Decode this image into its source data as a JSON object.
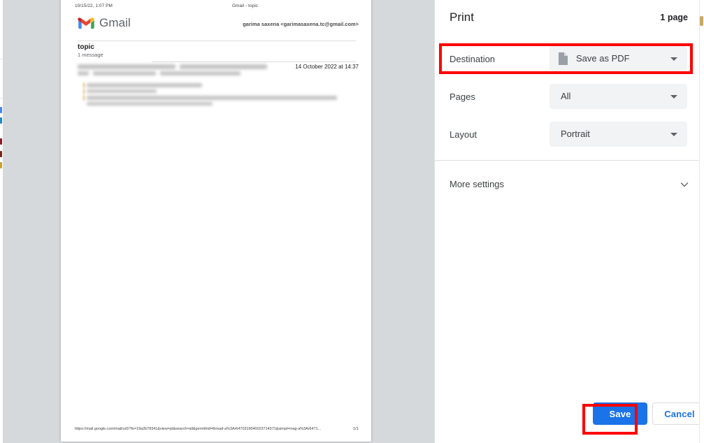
{
  "dialog": {
    "title": "Print",
    "page_count": "1 page",
    "settings": [
      {
        "id": "destination",
        "label": "Destination",
        "value": "Save as PDF",
        "icon": "pdf-document-icon",
        "highlighted": true
      },
      {
        "id": "pages",
        "label": "Pages",
        "value": "All",
        "icon": null,
        "highlighted": false
      },
      {
        "id": "layout",
        "label": "Layout",
        "value": "Portrait",
        "icon": null,
        "highlighted": false
      }
    ],
    "more_settings": {
      "label": "More settings",
      "icon": "chevron-down-icon",
      "expanded": false
    },
    "footer": {
      "save_label": "Save",
      "cancel_label": "Cancel"
    }
  },
  "preview": {
    "document": {
      "header_left": "10/15/22, 1:07 PM",
      "header_right": "Gmail - topic",
      "brand": "Gmail",
      "brand_icon": "gmail-m-icon",
      "account": "garima saxena <garimasaxena.tc@gmail.com>",
      "subject": "topic",
      "message_count": "1 message",
      "message_date": "14 October 2022 at 14:37",
      "footer_url": "https://mail.google.com/mail/u/0/?ik=19a2b78341&view=pt&search=all&permthid=thread-a%3Ar6470319040023714371&simpl=msg-a%3Ar6471...",
      "footer_page": "1/1"
    }
  },
  "colors": {
    "accent_blue": "#1a73e8",
    "annotation_red": "#ff0000",
    "preview_background": "#d6d9dc",
    "select_background": "#f1f3f4",
    "panel_background": "#ffffff"
  }
}
